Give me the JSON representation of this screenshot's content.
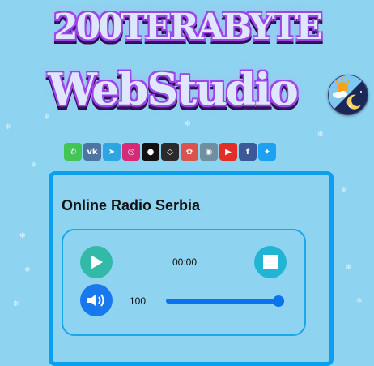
{
  "logo": {
    "line1": "200TERABYTE",
    "line2": "WebStudio"
  },
  "theme_toggle": {
    "icon": "day-night-icon"
  },
  "social_links": [
    {
      "name": "whatsapp-icon",
      "glyph": "✆",
      "color": "#43c553"
    },
    {
      "name": "vk-icon",
      "glyph": "vk",
      "color": "#4c75a3"
    },
    {
      "name": "telegram-icon",
      "glyph": "➤",
      "color": "#2ca5e0"
    },
    {
      "name": "instagram-icon",
      "glyph": "◎",
      "color": "#d62976"
    },
    {
      "name": "github-icon",
      "glyph": "●",
      "color": "#111111"
    },
    {
      "name": "codepen-icon",
      "glyph": "◇",
      "color": "#2b2b2b"
    },
    {
      "name": "sololearn-icon",
      "glyph": "✿",
      "color": "#d9534f"
    },
    {
      "name": "blender-icon",
      "glyph": "◉",
      "color": "#6f8fa0"
    },
    {
      "name": "youtube-icon",
      "glyph": "▶",
      "color": "#e52d27"
    },
    {
      "name": "facebook-icon",
      "glyph": "f",
      "color": "#3b5998"
    },
    {
      "name": "twitter-icon",
      "glyph": "✦",
      "color": "#1da1f2"
    }
  ],
  "player": {
    "title": "Online Radio Serbia",
    "time": "00:00",
    "volume_label": "100",
    "volume_fraction": 1.0,
    "colors": {
      "play": "#32b9a8",
      "stop": "#21b5d3",
      "volume": "#1879ee",
      "slider": "#0b73ee"
    }
  }
}
